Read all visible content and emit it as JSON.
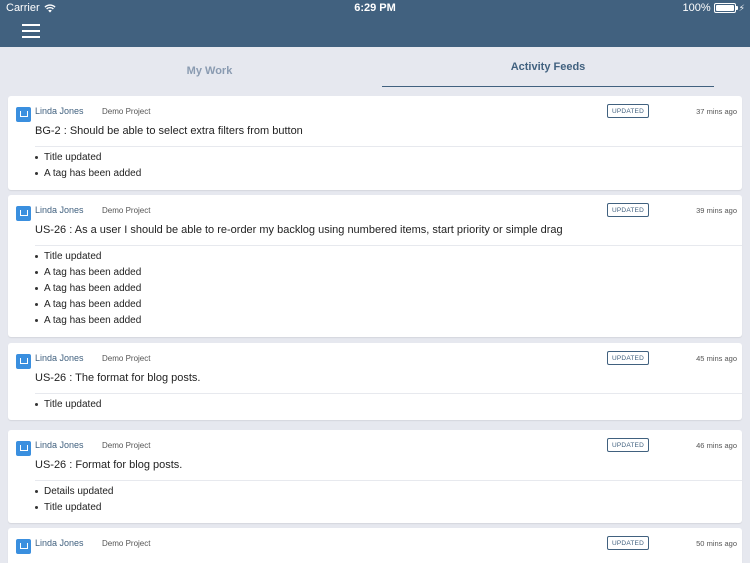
{
  "status_bar": {
    "carrier": "Carrier",
    "time": "6:29 PM",
    "battery": "100%"
  },
  "tabs": {
    "my_work": "My Work",
    "activity_feeds": "Activity Feeds"
  },
  "feed": [
    {
      "author": "Linda Jones",
      "project": "Demo Project",
      "badge": "UPDATED",
      "time": "37 mins ago",
      "title": "BG-2 : Should be able to select extra filters from button",
      "changes": [
        "Title updated",
        "A tag has been added"
      ]
    },
    {
      "author": "Linda Jones",
      "project": "Demo Project",
      "badge": "UPDATED",
      "time": "39 mins ago",
      "title": "US-26 : As a user I should be able to re-order my backlog using numbered items, start priority or simple drag",
      "changes": [
        "Title updated",
        "A tag has been added",
        "A tag has been added",
        "A tag has been added",
        "A tag has been added"
      ]
    },
    {
      "author": "Linda Jones",
      "project": "Demo Project",
      "badge": "UPDATED",
      "time": "45 mins ago",
      "title": "US-26 : The format for blog posts.",
      "changes": [
        "Title updated"
      ]
    },
    {
      "author": "Linda Jones",
      "project": "Demo Project",
      "badge": "UPDATED",
      "time": "46 mins ago",
      "title": "US-26 : Format for blog posts.",
      "changes": [
        "Details updated",
        "Title updated"
      ]
    },
    {
      "author": "Linda Jones",
      "project": "Demo Project",
      "badge": "UPDATED",
      "time": "50 mins ago",
      "title": "",
      "changes": []
    }
  ]
}
